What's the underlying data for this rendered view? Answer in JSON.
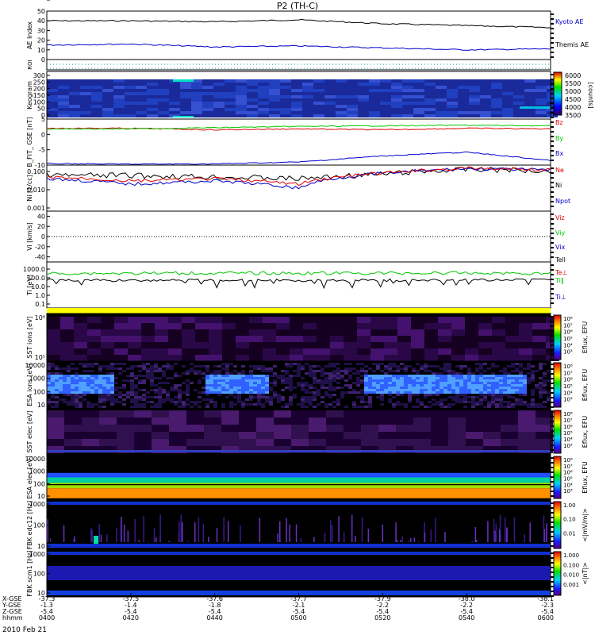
{
  "title": "P2 (TH-C)",
  "date_label": "2010 Feb 21",
  "colors": {
    "black": "#000000",
    "red": "#e00000",
    "green": "#00c800",
    "blue": "#0000cc",
    "bar_yellow": "#ffff00"
  },
  "chart_data": [
    {
      "type": "line",
      "panel": "ae",
      "ylabel": "AE Index",
      "ylim": [
        0,
        50
      ],
      "yticks": [
        "50",
        "40",
        "30",
        "20",
        "10",
        "0"
      ],
      "x": [
        "0400",
        "0420",
        "0440",
        "0500",
        "0520",
        "0540",
        "0600"
      ],
      "series": [
        {
          "name": "Kyoto AE",
          "color": "#0000cc",
          "values": [
            40,
            40,
            39,
            41,
            37,
            35,
            33
          ]
        },
        {
          "name": "Themis AE",
          "color": "#0000cc",
          "values": [
            15,
            16,
            13,
            14,
            12,
            10,
            11
          ]
        }
      ]
    },
    {
      "type": "heatmap",
      "panel": "roi",
      "ylabel": "ROI"
    },
    {
      "type": "heatmap",
      "panel": "keogram",
      "ylabel": "Keogram",
      "yticks": [
        "300",
        "250",
        "200",
        "150",
        "100",
        "50",
        "0"
      ],
      "colorbar": {
        "ticks": [
          "6000",
          "5500",
          "5000",
          "4500",
          "4000",
          "3500"
        ],
        "label": "[counts]"
      }
    },
    {
      "type": "line",
      "panel": "bfield",
      "ylabel": "B_FIT_ GSE [nT]",
      "ylim": [
        -10,
        5
      ],
      "yticks": [
        "5",
        "0",
        "-5",
        "-10"
      ],
      "x": [
        "0400",
        "0420",
        "0440",
        "0500",
        "0520",
        "0540",
        "0600"
      ],
      "series": [
        {
          "name": "Bz",
          "color": "#e00000",
          "values": [
            2,
            2,
            1.5,
            1.8,
            1.5,
            2,
            1.8
          ]
        },
        {
          "name": "By",
          "color": "#00c800",
          "values": [
            1.8,
            1.8,
            2.2,
            2.6,
            2.8,
            3.0,
            2.8
          ]
        },
        {
          "name": "Bx",
          "color": "#0000cc",
          "values": [
            -9.5,
            -9.7,
            -9.6,
            -9.0,
            -7.0,
            -5.8,
            -8.5
          ]
        }
      ]
    },
    {
      "type": "line",
      "panel": "density",
      "ylabel": "Ni [1/cc]",
      "yticks": [
        "0.100",
        "0.010",
        "0.001"
      ],
      "x": [
        "0400",
        "0420",
        "0440",
        "0500",
        "0520",
        "0540",
        "0600"
      ],
      "series": [
        {
          "name": "Ne",
          "color": "#e00000",
          "values": [
            0.05,
            0.03,
            0.04,
            0.02,
            0.08,
            0.15,
            0.12
          ]
        },
        {
          "name": "Ni",
          "color": "#000000",
          "values": [
            0.06,
            0.06,
            0.05,
            0.04,
            0.07,
            0.13,
            0.11
          ]
        },
        {
          "name": "Npot",
          "color": "#0000cc",
          "values": [
            0.04,
            0.02,
            0.03,
            0.012,
            0.08,
            0.14,
            0.12
          ]
        }
      ]
    },
    {
      "type": "line",
      "panel": "velocity",
      "ylabel": "Vi [km/s]",
      "ylim": [
        -50,
        50
      ],
      "yticks": [
        "40",
        "20",
        "0",
        "-20",
        "-40"
      ],
      "series": [
        {
          "name": "Viz",
          "color": "#e00000"
        },
        {
          "name": "Viy",
          "color": "#00c800"
        },
        {
          "name": "Vix",
          "color": "#0000cc"
        }
      ]
    },
    {
      "type": "line",
      "panel": "temperature",
      "ylabel": "Ti [eV]",
      "yticks": [
        "1000.0",
        "100.0",
        "10.0",
        "1.0",
        "0.1"
      ],
      "x": [
        "0400",
        "0420",
        "0440",
        "0500",
        "0520",
        "0540",
        "0600"
      ],
      "series": [
        {
          "name": "Tell",
          "color": "#000000",
          "values": [
            60,
            50,
            55,
            50,
            55,
            55,
            60
          ]
        },
        {
          "name": "Te⊥",
          "color": "#e00000",
          "values": [
            300,
            320,
            330,
            320,
            330,
            340,
            300
          ]
        },
        {
          "name": "Ti‖",
          "color": "#00c800",
          "values": [
            320,
            330,
            340,
            330,
            340,
            350,
            320
          ]
        },
        {
          "name": "Ti⊥",
          "color": "#0000cc"
        }
      ]
    },
    {
      "type": "heatmap",
      "panel": "sst_ion",
      "ylabel": "SST ions [eV]",
      "yticks": [
        "10⁶",
        "10⁵"
      ],
      "colorbar": {
        "ticks": [
          "10⁸",
          "10⁷",
          "10⁶",
          "10⁵",
          "10⁴",
          "10³"
        ],
        "label": "Eflux, EFU"
      }
    },
    {
      "type": "heatmap",
      "panel": "esa_ion",
      "ylabel": "ESA ions [eV]",
      "yticks": [
        "10000",
        "1000",
        "100",
        "10"
      ],
      "colorbar": {
        "ticks": [
          "10⁸",
          "10⁷",
          "10⁶",
          "10⁵",
          "10⁴",
          "10³"
        ],
        "label": "Eflux, EFU"
      }
    },
    {
      "type": "heatmap",
      "panel": "sst_elec",
      "ylabel": "SST elec [eV]",
      "yticks": [
        "10⁵"
      ],
      "colorbar": {
        "ticks": [
          "10⁸",
          "10⁷",
          "10⁶",
          "10⁵",
          "10⁴",
          "10³"
        ],
        "label": "Eflux, EFU"
      }
    },
    {
      "type": "heatmap",
      "panel": "esa_elec",
      "ylabel": "ESA elec [eV]",
      "yticks": [
        "10000",
        "1000",
        "100",
        "10"
      ],
      "colorbar": {
        "ticks": [
          "10⁸",
          "10⁷",
          "10⁶",
          "10⁵",
          "10⁴",
          "10³"
        ],
        "label": "Eflux, EFU"
      }
    },
    {
      "type": "heatmap",
      "panel": "fbk_e",
      "ylabel": "FBK edc12 [Hz]",
      "yticks": [
        "1000",
        "100",
        "10"
      ],
      "colorbar": {
        "ticks": [
          "1.00",
          "0.10",
          "0.01"
        ],
        "label": "<|mV/m|>"
      }
    },
    {
      "type": "heatmap",
      "panel": "fbk_b",
      "ylabel": "FBK scm1 [Hz]",
      "yticks": [
        "1000",
        "100",
        "10"
      ],
      "colorbar": {
        "ticks": [
          "1.000",
          "0.100",
          "0.010",
          "0.001"
        ],
        "label": "<|nT|>"
      }
    }
  ],
  "xaxis": {
    "row_labels": [
      "X-GSE",
      "Y-GSE",
      "Z-GSE",
      "hhmm"
    ],
    "columns": [
      {
        "x": "-37.3",
        "y": "-1.3",
        "z": "-5.4",
        "t": "0400"
      },
      {
        "x": "-37.5",
        "y": "-1.4",
        "z": "-5.4",
        "t": "0420"
      },
      {
        "x": "-37.6",
        "y": "-1.8",
        "z": "-5.4",
        "t": "0440"
      },
      {
        "x": "-37.7",
        "y": "-2.1",
        "z": "-5.4",
        "t": "0500"
      },
      {
        "x": "-37.9",
        "y": "-2.2",
        "z": "-5.4",
        "t": "0520"
      },
      {
        "x": "-38.0",
        "y": "-2.2",
        "z": "-5.4",
        "t": "0540"
      },
      {
        "x": "-38.1",
        "y": "-2.3",
        "z": "-5.4",
        "t": "0600"
      }
    ]
  }
}
